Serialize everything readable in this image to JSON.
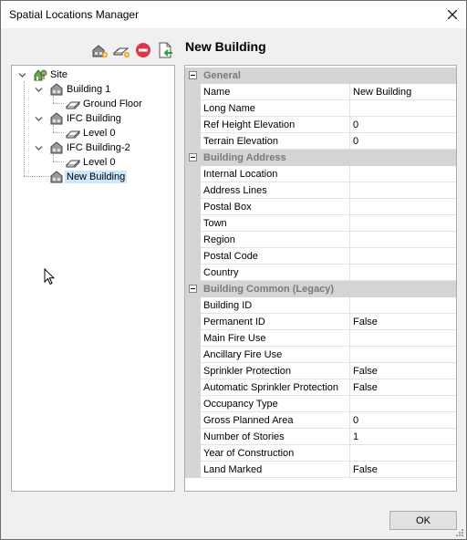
{
  "window": {
    "title": "Spatial Locations Manager"
  },
  "toolbar": {
    "buttons": [
      {
        "icon": "add-building-icon"
      },
      {
        "icon": "add-level-icon"
      },
      {
        "icon": "remove-icon"
      },
      {
        "icon": "import-icon"
      }
    ]
  },
  "tree": {
    "items": [
      {
        "label": "Site",
        "icon": "site-icon"
      },
      {
        "label": "Building 1",
        "icon": "building-icon"
      },
      {
        "label": "Ground Floor",
        "icon": "level-icon"
      },
      {
        "label": "IFC Building",
        "icon": "building-icon"
      },
      {
        "label": "Level 0",
        "icon": "level-icon"
      },
      {
        "label": "IFC Building-2",
        "icon": "building-icon"
      },
      {
        "label": "Level 0",
        "icon": "level-icon"
      },
      {
        "label": "New Building",
        "icon": "building-icon",
        "selected": true
      }
    ]
  },
  "properties": {
    "heading": "New Building",
    "categories": [
      {
        "title": "General",
        "rows": [
          {
            "name": "Name",
            "value": "New Building"
          },
          {
            "name": "Long Name",
            "value": ""
          },
          {
            "name": "Ref Height Elevation",
            "value": "0"
          },
          {
            "name": "Terrain Elevation",
            "value": "0"
          }
        ]
      },
      {
        "title": "Building Address",
        "rows": [
          {
            "name": "Internal Location",
            "value": ""
          },
          {
            "name": "Address Lines",
            "value": ""
          },
          {
            "name": "Postal Box",
            "value": ""
          },
          {
            "name": "Town",
            "value": ""
          },
          {
            "name": "Region",
            "value": ""
          },
          {
            "name": "Postal Code",
            "value": ""
          },
          {
            "name": "Country",
            "value": ""
          }
        ]
      },
      {
        "title": "Building Common (Legacy)",
        "rows": [
          {
            "name": "Building ID",
            "value": ""
          },
          {
            "name": "Permanent ID",
            "value": "False"
          },
          {
            "name": "Main Fire Use",
            "value": ""
          },
          {
            "name": "Ancillary Fire Use",
            "value": ""
          },
          {
            "name": "Sprinkler Protection",
            "value": "False"
          },
          {
            "name": "Automatic Sprinkler Protection",
            "value": "False"
          },
          {
            "name": "Occupancy Type",
            "value": ""
          },
          {
            "name": "Gross Planned Area",
            "value": "0"
          },
          {
            "name": "Number of Stories",
            "value": "1"
          },
          {
            "name": "Year of Construction",
            "value": ""
          },
          {
            "name": "Land Marked",
            "value": "False"
          }
        ]
      }
    ]
  },
  "footer": {
    "ok_label": "OK"
  },
  "colors": {
    "selection": "#cce8ff",
    "category_bg": "#d4d4d4",
    "remove_red": "#e0364b",
    "import_green": "#2e9e3a"
  }
}
